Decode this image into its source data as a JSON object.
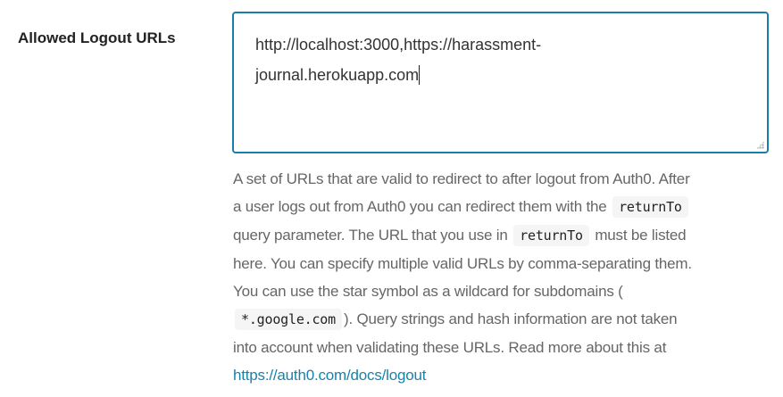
{
  "field": {
    "label": "Allowed Logout URLs",
    "value_line1": "http://localhost:3000,https://harassment-",
    "value_line2": "journal.herokuapp.com"
  },
  "help": {
    "l1": "A set of URLs that are valid to redirect to after logout from Auth0. After",
    "l2": "a user logs out from Auth0 you can redirect them with the ",
    "code1": "returnTo",
    "l3a": "query parameter. The URL that you use in ",
    "code2": "returnTo",
    "l3b": " must be listed",
    "l4": "here. You can specify multiple valid URLs by comma-separating them.",
    "l5": "You can use the star symbol as a wildcard for subdomains (",
    "code3": "*.google.com",
    "l6": "). Query strings and hash information are not taken",
    "l7": "into account when validating these URLs. Read more about this at",
    "link": "https://auth0.com/docs/logout"
  },
  "colors": {
    "accent": "#1a7fa8",
    "link": "#1a82a9",
    "help_text": "#666666"
  }
}
